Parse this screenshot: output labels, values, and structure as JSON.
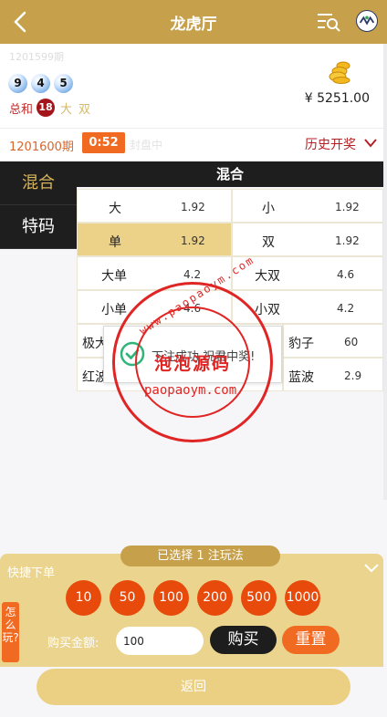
{
  "header": {
    "title": "龙虎厅"
  },
  "draw": {
    "last_period": "1201599期",
    "balls": [
      "9",
      "4",
      "5"
    ],
    "sum_label": "总和",
    "sum_value": "18",
    "size_tag": "大",
    "parity_tag": "双",
    "balance": "¥ 5251.00"
  },
  "period_bar": {
    "period": "1201600期",
    "countdown": "0:52",
    "status": "封盘中",
    "history_label": "历史开奖"
  },
  "side_tabs": [
    {
      "label": "混合"
    },
    {
      "label": "特码"
    }
  ],
  "panel": {
    "title": "混合",
    "bets": [
      {
        "name": "大",
        "odds": "1.92"
      },
      {
        "name": "小",
        "odds": "1.92"
      },
      {
        "name": "单",
        "odds": "1.92"
      },
      {
        "name": "双",
        "odds": "1.92"
      },
      {
        "name": "大单",
        "odds": "4.2"
      },
      {
        "name": "大双",
        "odds": "4.6"
      },
      {
        "name": "小单",
        "odds": "4.6"
      },
      {
        "name": "小双",
        "odds": "4.2"
      },
      {
        "name": "极大",
        "odds": ""
      },
      {
        "name": "豹子",
        "odds": "60"
      },
      {
        "name": "红波",
        "odds": ""
      },
      {
        "name": "蓝波",
        "odds": "2.9"
      }
    ]
  },
  "toast": {
    "message": "下注成功,祝君中奖!"
  },
  "watermark": {
    "cn": "泡泡源码",
    "url": "paopaoym.com",
    "arc": "www.paopaoym.com"
  },
  "quick_bet": {
    "selected": "已选择 1 注玩法",
    "title": "快捷下单",
    "chips": [
      "10",
      "50",
      "100",
      "200",
      "500",
      "1000"
    ],
    "howto": "怎么玩?",
    "amount_label": "购买金额:",
    "amount_value": "100",
    "buy_label": "购买",
    "reset_label": "重置",
    "return_label": "返回"
  }
}
